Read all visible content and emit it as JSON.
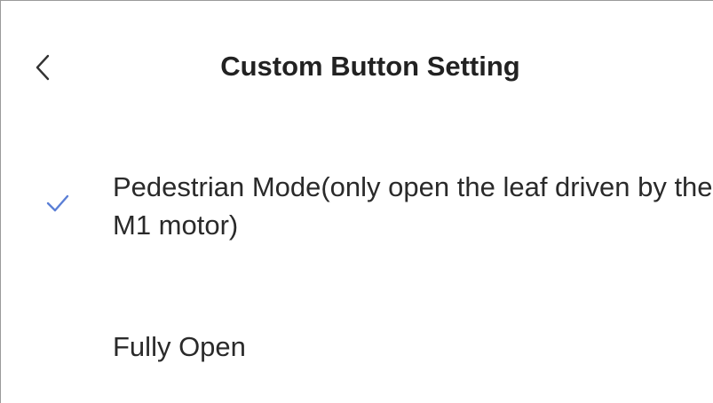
{
  "header": {
    "title": "Custom Button Setting",
    "back_icon": "chevron-left-icon"
  },
  "options": [
    {
      "label": "Pedestrian Mode(only open the leaf driven by the M1 motor)",
      "selected": true,
      "icon": "check-icon"
    },
    {
      "label": "Fully Open",
      "selected": false
    }
  ],
  "colors": {
    "accent": "#5b7fd6",
    "text": "#222222",
    "border": "#9a9a9a"
  }
}
